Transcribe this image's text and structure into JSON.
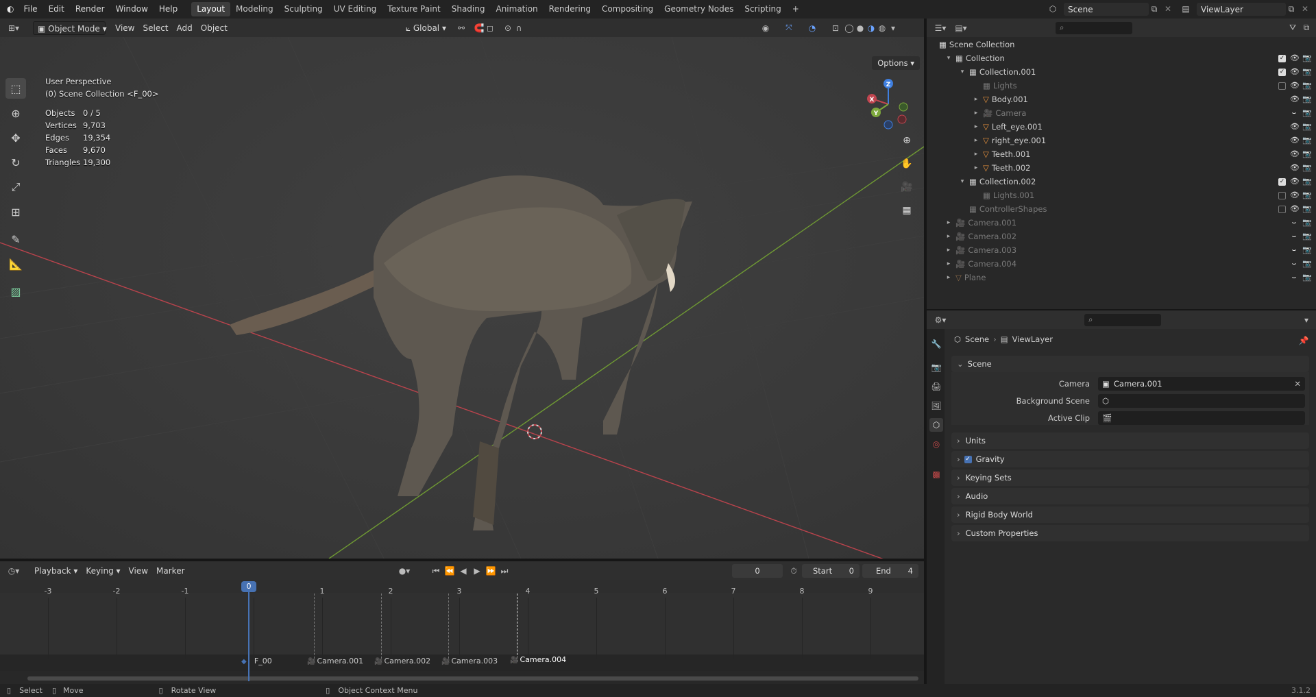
{
  "menu": {
    "items": [
      "File",
      "Edit",
      "Render",
      "Window",
      "Help"
    ]
  },
  "workspaces": {
    "tabs": [
      "Layout",
      "Modeling",
      "Sculpting",
      "UV Editing",
      "Texture Paint",
      "Shading",
      "Animation",
      "Rendering",
      "Compositing",
      "Geometry Nodes",
      "Scripting"
    ],
    "active": "Layout",
    "add": "+"
  },
  "scene_selector": {
    "value": "Scene"
  },
  "viewlayer_selector": {
    "value": "ViewLayer"
  },
  "viewport": {
    "mode": "Object Mode",
    "menus": [
      "View",
      "Select",
      "Add",
      "Object"
    ],
    "orientation": "Global",
    "options_label": "Options",
    "overlay_title": "User Perspective",
    "overlay_subtitle": "(0) Scene Collection <F_00>",
    "stats": [
      {
        "k": "Objects",
        "v": "0 / 5"
      },
      {
        "k": "Vertices",
        "v": "9,703"
      },
      {
        "k": "Edges",
        "v": "19,354"
      },
      {
        "k": "Faces",
        "v": "9,670"
      },
      {
        "k": "Triangles",
        "v": "19,300"
      }
    ],
    "gizmo_axes": [
      "Z",
      "X",
      "Y"
    ]
  },
  "outliner": {
    "root": "Scene Collection",
    "rows": [
      {
        "name": "Collection",
        "indent": 1,
        "icon": "collection-icon",
        "dim": false,
        "arrow": "down",
        "check": true
      },
      {
        "name": "Collection.001",
        "indent": 2,
        "icon": "collection-icon",
        "dim": false,
        "arrow": "down",
        "check": true
      },
      {
        "name": "Lights",
        "indent": 3,
        "icon": "collection-icon",
        "dim": true,
        "arrow": "",
        "check": false
      },
      {
        "name": "Body.001",
        "indent": 3,
        "icon": "mesh-icon",
        "dim": false,
        "arrow": "right",
        "check": null
      },
      {
        "name": "Camera",
        "indent": 3,
        "icon": "camera-icon",
        "dim": true,
        "arrow": "right",
        "check": null
      },
      {
        "name": "Left_eye.001",
        "indent": 3,
        "icon": "mesh-icon",
        "dim": false,
        "arrow": "right",
        "check": null
      },
      {
        "name": "right_eye.001",
        "indent": 3,
        "icon": "mesh-icon",
        "dim": false,
        "arrow": "right",
        "check": null
      },
      {
        "name": "Teeth.001",
        "indent": 3,
        "icon": "mesh-icon",
        "dim": false,
        "arrow": "right",
        "check": null
      },
      {
        "name": "Teeth.002",
        "indent": 3,
        "icon": "mesh-icon",
        "dim": false,
        "arrow": "right",
        "check": null
      },
      {
        "name": "Collection.002",
        "indent": 2,
        "icon": "collection-icon",
        "dim": false,
        "arrow": "down",
        "check": true
      },
      {
        "name": "Lights.001",
        "indent": 3,
        "icon": "collection-icon",
        "dim": true,
        "arrow": "",
        "check": false
      },
      {
        "name": "ControllerShapes",
        "indent": 2,
        "icon": "collection-icon",
        "dim": true,
        "arrow": "",
        "check": false
      },
      {
        "name": "Camera.001",
        "indent": 1,
        "icon": "camera-icon",
        "dim": true,
        "arrow": "right",
        "check": null
      },
      {
        "name": "Camera.002",
        "indent": 1,
        "icon": "camera-icon",
        "dim": true,
        "arrow": "right",
        "check": null
      },
      {
        "name": "Camera.003",
        "indent": 1,
        "icon": "camera-icon",
        "dim": true,
        "arrow": "right",
        "check": null
      },
      {
        "name": "Camera.004",
        "indent": 1,
        "icon": "camera-icon",
        "dim": true,
        "arrow": "right",
        "check": null
      },
      {
        "name": "Plane",
        "indent": 1,
        "icon": "mesh-icon",
        "dim": true,
        "arrow": "right",
        "check": null
      }
    ]
  },
  "properties": {
    "breadcrumb": [
      "Scene",
      "ViewLayer"
    ],
    "section": "Scene",
    "fields": [
      {
        "label": "Camera",
        "value": "Camera.001"
      },
      {
        "label": "Background Scene",
        "value": ""
      },
      {
        "label": "Active Clip",
        "value": ""
      }
    ],
    "subsections": [
      "Units",
      "Gravity",
      "Keying Sets",
      "Audio",
      "Rigid Body World",
      "Custom Properties"
    ],
    "gravity_checked": true
  },
  "timeline": {
    "menus": [
      "Playback",
      "Keying",
      "View",
      "Marker"
    ],
    "current_frame": "0",
    "start_label": "Start",
    "start": "0",
    "end_label": "End",
    "end": "4",
    "ticks": [
      "-3",
      "-2",
      "-1",
      "0",
      "1",
      "2",
      "3",
      "4",
      "5",
      "6",
      "7",
      "8",
      "9"
    ],
    "markers": [
      "F_00",
      "Camera.001",
      "Camera.002",
      "Camera.003",
      "Camera.004"
    ]
  },
  "statusbar": {
    "items": [
      "Select",
      "Move",
      "Rotate View",
      "Object Context Menu"
    ],
    "version": "3.1.2"
  },
  "colors": {
    "accent": "#4772b3",
    "x_axis": "#c0454f",
    "y_axis": "#7da83c",
    "z_axis": "#3f7fe0",
    "mesh": "#e6913c",
    "camera": "#5a9c63"
  }
}
